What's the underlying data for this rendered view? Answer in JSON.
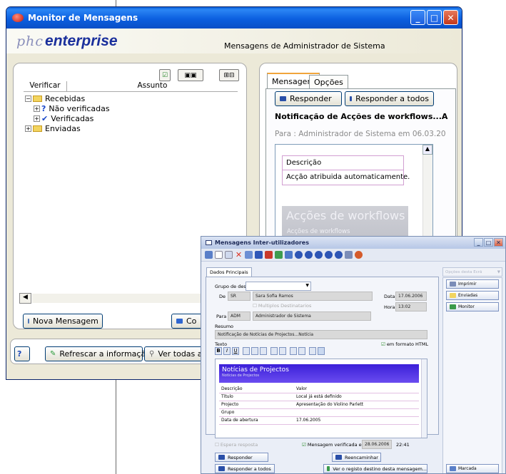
{
  "main_window": {
    "title": "Monitor de Mensagens",
    "brand_phc": "phc",
    "brand_enterprise": "enterprise",
    "subtitle": "Mensagens de Administrador de Sistema",
    "columns": [
      "Verificar",
      "Assunto"
    ],
    "tree": {
      "received": "Recebidas",
      "unverified": "Não verificadas",
      "verified": "Verificadas",
      "sent": "Enviadas"
    },
    "new_message_button": "Nova Mensagem",
    "partial_button": "Co",
    "refresh_button": "Refrescar a informação",
    "see_all_button": "Ver todas as",
    "tabs": [
      "Mensagem",
      "Opções"
    ],
    "reply_button": "Responder",
    "reply_all_button": "Responder a todos",
    "message_title": "Notificação de Acções de workflows...A",
    "message_to": "Para : Administrador de Sistema em 06.03.20",
    "message_table_header": "Descrição",
    "message_table_value": "Acção atribuida automaticamente.",
    "banner_title": "Acções de workflows",
    "banner_subtitle": "Acções de workflows"
  },
  "second_window": {
    "title": "Mensagens Inter-utilizadores",
    "tab": "Dados Principais",
    "group_label": "Grupo de destino",
    "from_label": "De",
    "from_code": "SR",
    "from_name": "Sara Sofia Ramos",
    "multiple_recipients": "Multiplos Destinatarios",
    "date_label": "Data",
    "date_value": "17.06.2006",
    "time_label": "Hora",
    "time_value": "13:02",
    "to_label": "Para",
    "to_code": "ADM",
    "to_name": "Administrador de Sistema",
    "summary_label": "Resumo",
    "summary_value": "Notificação de Notícias de Projectos...Notícia",
    "text_label": "Texto",
    "html_format": "em formato HTML",
    "news_banner_title": "Notícias de Projectos",
    "news_banner_subtitle": "Notícias de Projectos",
    "table_headers": [
      "Descrição",
      "Valor"
    ],
    "table_rows": [
      [
        "Título",
        "Local já está definido"
      ],
      [
        "Projecto",
        "Apresentação do Violino Parlett"
      ],
      [
        "Grupo",
        ""
      ],
      [
        "Data de abertura",
        "17.06.2005"
      ]
    ],
    "expects_reply": "Espera resposta",
    "verified_message": "Mensagem verificada em",
    "verified_date": "28.06.2006",
    "verified_time": "22:41",
    "reply_button": "Responder",
    "forward_button": "Reencaminhar",
    "reply_all_button": "Responder a todos",
    "see_record_button": "Ver o registo destino desta mensagem...",
    "side_options": "Opções desta Ecrã",
    "side_buttons": [
      "Imprimir",
      "Enviadas",
      "Monitor"
    ],
    "marked_button": "Marcada"
  }
}
